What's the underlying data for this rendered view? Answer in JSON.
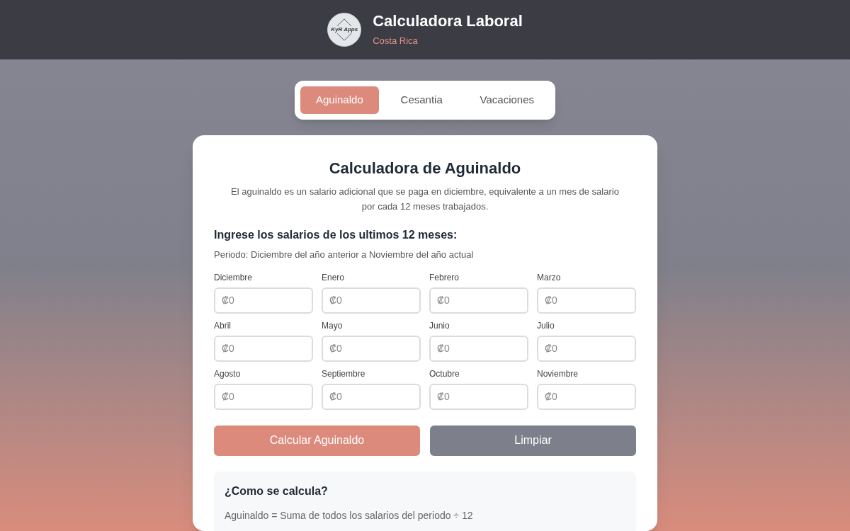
{
  "header": {
    "logo_text": "KyR Apps",
    "title": "Calculadora Laboral",
    "subtitle": "Costa Rica"
  },
  "tabs": [
    {
      "label": "Aguinaldo",
      "selected": true
    },
    {
      "label": "Cesantia",
      "selected": false
    },
    {
      "label": "Vacaciones",
      "selected": false
    }
  ],
  "card": {
    "title": "Calculadora de Aguinaldo",
    "description": "El aguinaldo es un salario adicional que se paga en diciembre, equivalente a un mes de salario por cada 12 meses trabajados.",
    "section_title": "Ingrese los salarios de los ultimos 12 meses:",
    "period": "Periodo: Diciembre del año anterior a Noviembre del año actual",
    "fields": [
      {
        "label": "Diciembre",
        "placeholder": "₡0"
      },
      {
        "label": "Enero",
        "placeholder": "₡0"
      },
      {
        "label": "Febrero",
        "placeholder": "₡0"
      },
      {
        "label": "Marzo",
        "placeholder": "₡0"
      },
      {
        "label": "Abril",
        "placeholder": "₡0"
      },
      {
        "label": "Mayo",
        "placeholder": "₡0"
      },
      {
        "label": "Junio",
        "placeholder": "₡0"
      },
      {
        "label": "Julio",
        "placeholder": "₡0"
      },
      {
        "label": "Agosto",
        "placeholder": "₡0"
      },
      {
        "label": "Septiembre",
        "placeholder": "₡0"
      },
      {
        "label": "Octubre",
        "placeholder": "₡0"
      },
      {
        "label": "Noviembre",
        "placeholder": "₡0"
      }
    ],
    "buttons": [
      {
        "label": "Calcular Aguinaldo",
        "kind": "primary"
      },
      {
        "label": "Limpiar",
        "kind": "secondary"
      }
    ],
    "info": {
      "title": "¿Como se calcula?",
      "formula": "Aguinaldo = Suma de todos los salarios del periodo ÷ 12"
    }
  }
}
